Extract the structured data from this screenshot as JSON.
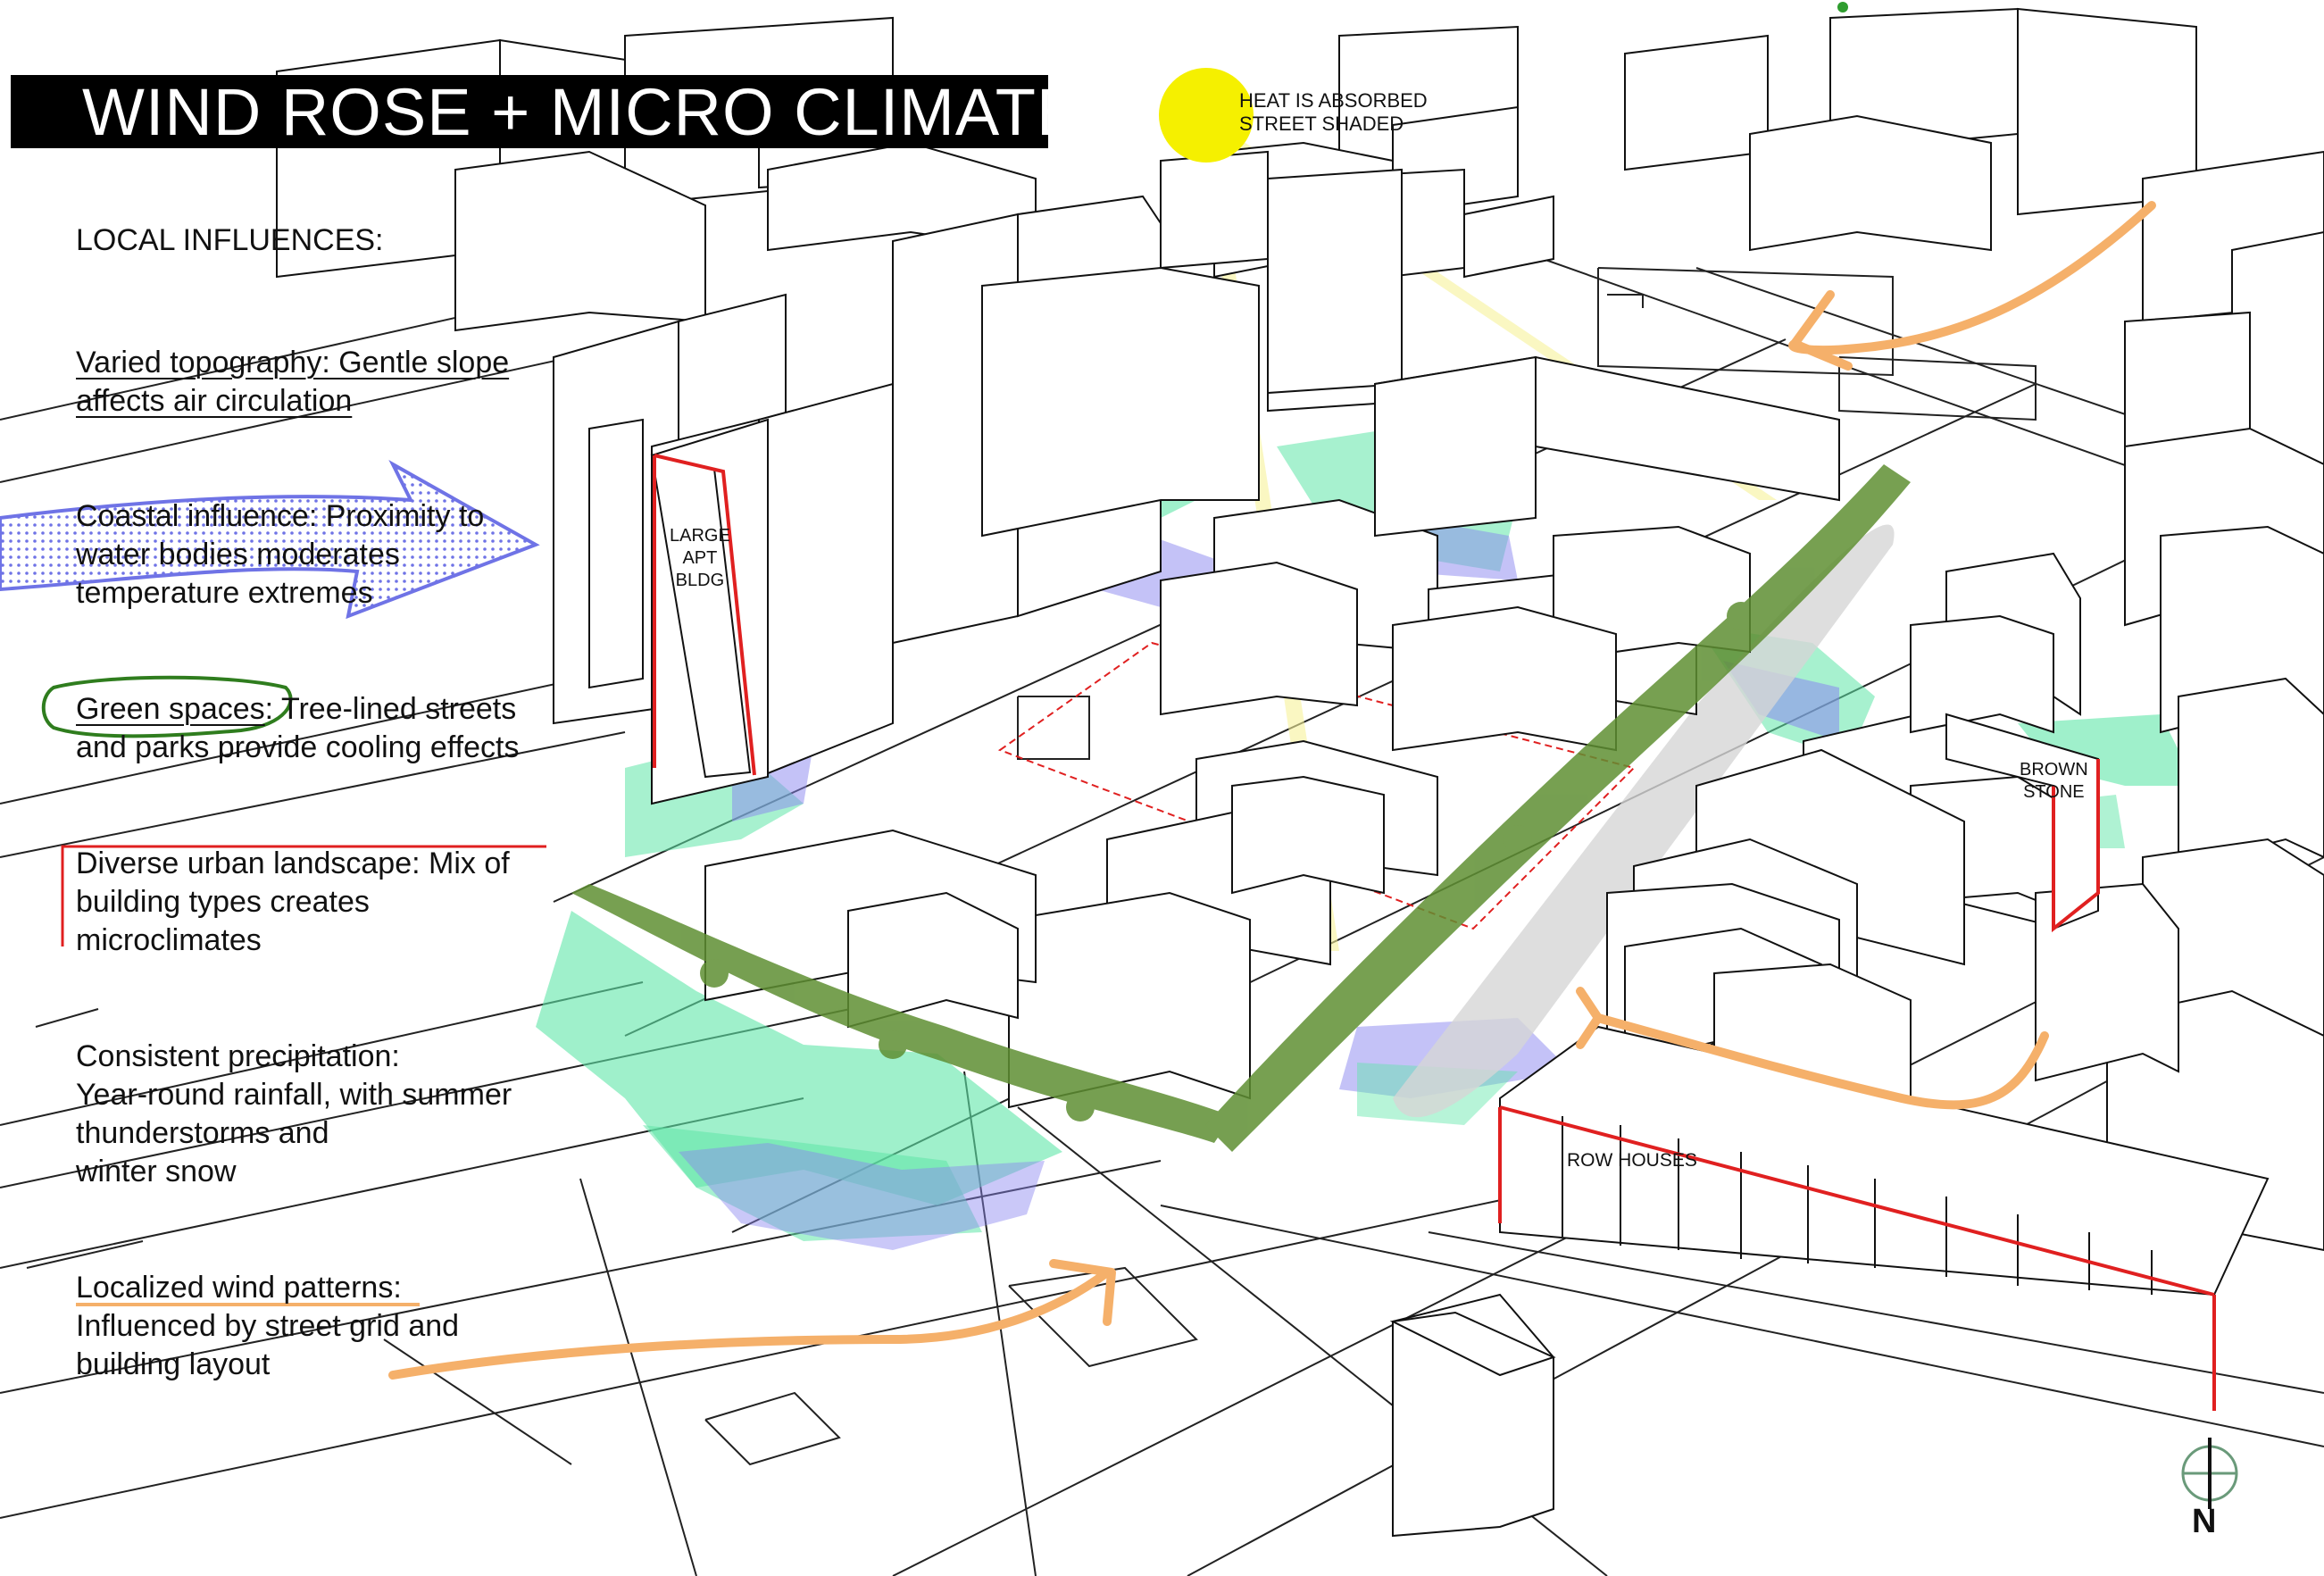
{
  "title": "WIND ROSE + MICRO CLIMATE",
  "sun_note": {
    "line1": "HEAT IS ABSORBED",
    "line2": "STREET SHADED"
  },
  "influences": {
    "heading": "LOCAL INFLUENCES:",
    "topography": {
      "line1": "Varied topography: Gentle slope",
      "line2": "affects air circulation"
    },
    "coastal": {
      "line1": "Coastal influence: Proximity to",
      "line2": "water bodies moderates",
      "line3": "temperature extremes"
    },
    "green": {
      "term": "Green spaces",
      "rest": ": Tree-lined streets",
      "line2": "and parks provide cooling effects"
    },
    "urban": {
      "line1": "Diverse urban landscape: Mix of",
      "line2": "building types creates",
      "line3": "microclimates"
    },
    "precipitation": {
      "line1": "Consistent precipitation:",
      "line2": "Year-round rainfall, with summer",
      "line3": "thunderstorms and",
      "line4": "winter snow"
    },
    "wind": {
      "line1": "Localized wind patterns:",
      "line2": "Influenced by street grid and",
      "line3": "building layout"
    }
  },
  "building_labels": {
    "large_apt": {
      "line1": "LARGE",
      "line2": "APT",
      "line3": "BLDG"
    },
    "brownstone": {
      "line1": "BROWN",
      "line2": "STONE"
    },
    "row_houses": "ROW HOUSES"
  },
  "north_label": "N",
  "colors": {
    "title_bg": "#000000",
    "title_text": "#ffffff",
    "sun": "#f5f000",
    "sun_ray": "#f7f29a",
    "wind_arrow": "#f5b06a",
    "coastal": "#6f73e6",
    "green_space": "#2f7d1e",
    "highlight_building": "#e02020",
    "wind_rose_green": "#5fe6a8",
    "wind_rose_blue": "#8a86f0",
    "tree": "#5f8f33",
    "shade": "#d6d6d6"
  },
  "icons": {
    "sun": "sun-icon",
    "north_arrow": "north-arrow-icon"
  }
}
